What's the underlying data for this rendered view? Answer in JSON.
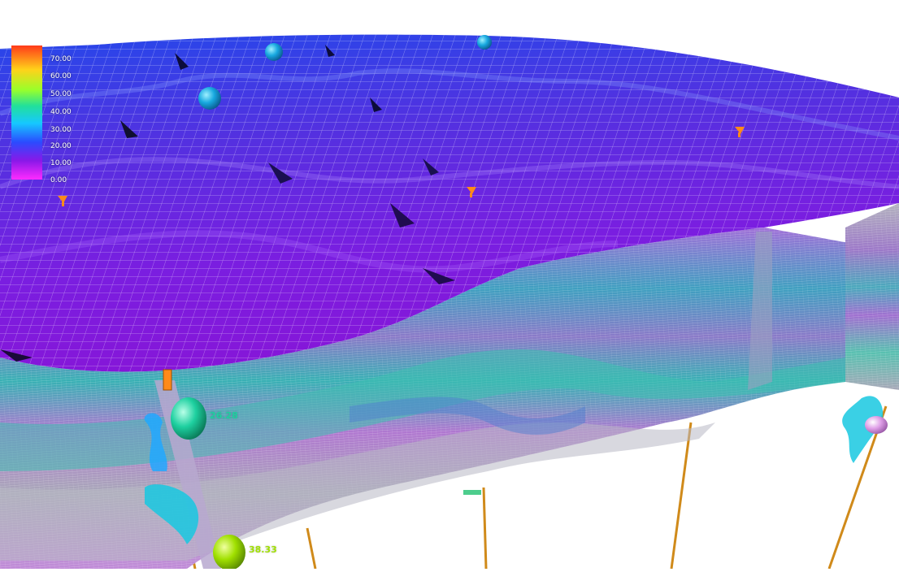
{
  "colors": {
    "surface_top": "#2a55e8",
    "surface_mid": "#6a22d8",
    "surface_low": "#8a1ae0",
    "section_violet": "#b46ad8",
    "section_teal": "#4ab4b8",
    "section_gray": "#a8a8b4",
    "well_trajectory": "#d08a1a",
    "marker_cyan": "#18a8e0",
    "marker_green": "#1ed0a0",
    "marker_lime": "#a0e000",
    "marker_pink": "#e0a0e8"
  },
  "legend": {
    "ticks": [
      "70.00",
      "60.00",
      "50.00",
      "40.00",
      "30.00",
      "20.00",
      "10.00",
      "0.00"
    ]
  },
  "wells": {
    "front_top_value": "26.28",
    "front_bottom_value": "38.33"
  }
}
